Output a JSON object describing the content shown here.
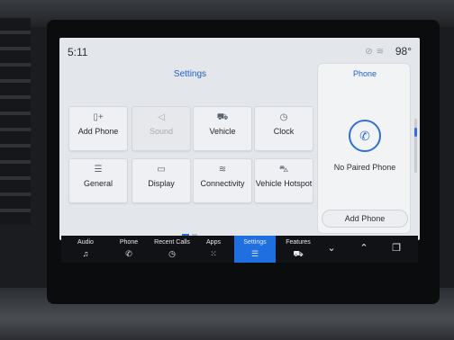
{
  "status": {
    "time": "5:11",
    "temperature": "98°",
    "icons": [
      "mute-icon",
      "wifi-icon"
    ]
  },
  "settings": {
    "title": "Settings",
    "tiles": [
      {
        "label": "Add Phone",
        "icon": "add-phone-icon",
        "enabled": true
      },
      {
        "label": "Sound",
        "icon": "speaker-icon",
        "enabled": false
      },
      {
        "label": "Vehicle",
        "icon": "vehicle-icon",
        "enabled": true
      },
      {
        "label": "Clock",
        "icon": "clock-icon",
        "enabled": true
      },
      {
        "label": "General",
        "icon": "sliders-icon",
        "enabled": true
      },
      {
        "label": "Display",
        "icon": "display-icon",
        "enabled": true
      },
      {
        "label": "Connectivity",
        "icon": "wifi-icon",
        "enabled": true
      },
      {
        "label": "Vehicle Hotspot",
        "icon": "hotspot-icon",
        "enabled": true
      }
    ],
    "page_indicator": {
      "pages": 2,
      "current": 1
    }
  },
  "phone_panel": {
    "title": "Phone",
    "status": "No Paired Phone",
    "button_label": "Add Phone"
  },
  "dock": {
    "items": [
      {
        "label": "Audio",
        "icon": "music-note-icon",
        "active": false
      },
      {
        "label": "Phone",
        "icon": "phone-icon",
        "active": false
      },
      {
        "label": "Recent Calls",
        "icon": "history-icon",
        "active": false
      },
      {
        "label": "Apps",
        "icon": "apps-grid-icon",
        "active": false
      },
      {
        "label": "Settings",
        "icon": "sliders-icon",
        "active": true
      },
      {
        "label": "Features",
        "icon": "car-icon",
        "active": false
      },
      {
        "label": "",
        "icon": "chevron-down-icon",
        "active": false
      },
      {
        "label": "",
        "icon": "chevron-up-icon",
        "active": false
      },
      {
        "label": "",
        "icon": "multi-window-icon",
        "active": false
      }
    ]
  },
  "colors": {
    "accent": "#1f6fe0",
    "title_blue": "#1f5fc8",
    "screen_bg": "#e3e6ea",
    "dock_bg": "#101216"
  }
}
